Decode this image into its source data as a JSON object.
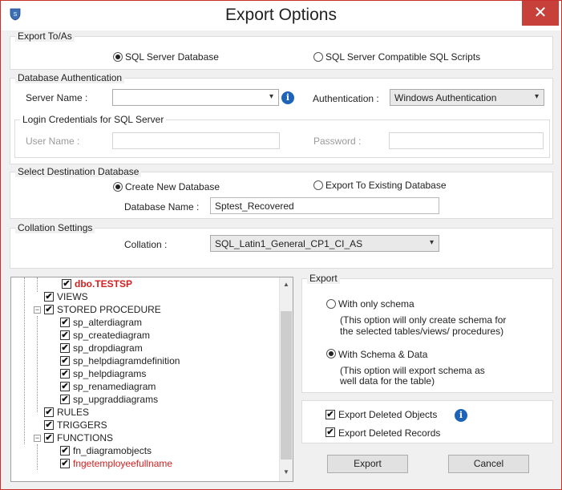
{
  "window": {
    "title": "Export Options",
    "close_glyph": "✕"
  },
  "export_to": {
    "legend": "Export To/As",
    "option_sql_server": "SQL Server Database",
    "option_scripts": "SQL Server Compatible SQL Scripts",
    "selected": "SQL Server Database"
  },
  "db_auth": {
    "legend": "Database Authentication",
    "server_name_label": "Server Name :",
    "server_name_value": "",
    "authentication_label": "Authentication :",
    "authentication_value": "Windows Authentication",
    "login": {
      "legend": "Login Credentials for SQL Server",
      "username_label": "User Name :",
      "password_label": "Password :"
    }
  },
  "destination": {
    "legend": "Select Destination Database",
    "option_new": "Create New Database",
    "option_existing": "Export To Existing Database",
    "selected": "Create New Database",
    "db_name_label": "Database Name :",
    "db_name_value": "Sptest_Recovered"
  },
  "collation": {
    "legend": "Collation Settings",
    "label": "Collation :",
    "value": "SQL_Latin1_General_CP1_CI_AS"
  },
  "tree": {
    "items": [
      {
        "label": "dbo.TESTSP",
        "checked": true,
        "style": "red-bold"
      },
      {
        "label": "VIEWS",
        "checked": true
      },
      {
        "label": "STORED PROCEDURE",
        "checked": true,
        "expander": "-"
      },
      {
        "label": "sp_alterdiagram",
        "checked": true
      },
      {
        "label": "sp_creatediagram",
        "checked": true
      },
      {
        "label": "sp_dropdiagram",
        "checked": true
      },
      {
        "label": "sp_helpdiagramdefinition",
        "checked": true
      },
      {
        "label": "sp_helpdiagrams",
        "checked": true
      },
      {
        "label": "sp_renamediagram",
        "checked": true
      },
      {
        "label": "sp_upgraddiagrams",
        "checked": true
      },
      {
        "label": "RULES",
        "checked": true
      },
      {
        "label": "TRIGGERS",
        "checked": true
      },
      {
        "label": "FUNCTIONS",
        "checked": true,
        "expander": "-"
      },
      {
        "label": "fn_diagramobjects",
        "checked": true
      },
      {
        "label": "fngetemployeefullname",
        "checked": true,
        "style": "red"
      }
    ]
  },
  "export": {
    "legend": "Export",
    "option_schema": "With only schema",
    "option_schema_desc_1": "(This option will only create schema for",
    "option_schema_desc_2": "the  selected tables/views/ procedures)",
    "option_schema_data": "With Schema & Data",
    "option_schema_data_desc_1": "(This option will export schema as",
    "option_schema_data_desc_2": "well data for the table)",
    "selected": "With Schema & Data"
  },
  "deleted": {
    "objects_label": "Export Deleted Objects",
    "records_label": "Export Deleted Records",
    "objects_checked": true,
    "records_checked": true
  },
  "buttons": {
    "export": "Export",
    "cancel": "Cancel"
  },
  "colors": {
    "close": "#c7403a",
    "info": "#1d63b8",
    "highlight_text": "#d42020"
  },
  "icons": {
    "check_glyph": "✔",
    "info_glyph": "i",
    "chevron_glyph": "▾",
    "scroll_up_glyph": "▲",
    "scroll_down_glyph": "▼",
    "expander_glyph": "−"
  }
}
